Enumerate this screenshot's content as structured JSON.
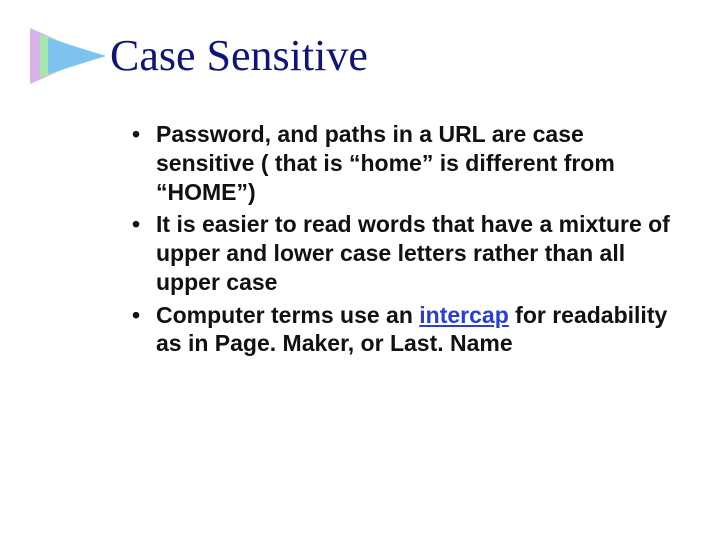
{
  "title": "Case Sensitive",
  "bullets": [
    "Password, and paths in a URL are case sensitive ( that is “home” is different from “HOME”)",
    "It is easier to read words that have a mixture of upper and lower case letters rather than all upper case",
    {
      "pre": "Computer terms use an ",
      "link": "intercap",
      "post": " for readability as in Page. Maker, or Last. Name"
    }
  ]
}
